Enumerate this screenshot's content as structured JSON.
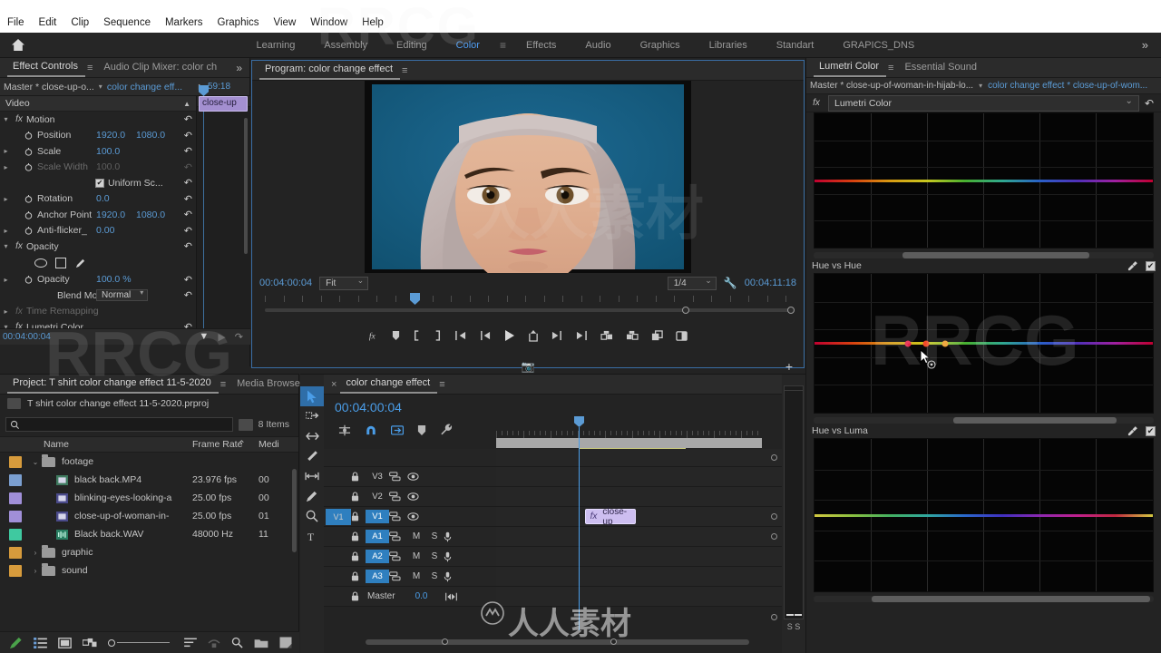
{
  "menu": {
    "items": [
      "File",
      "Edit",
      "Clip",
      "Sequence",
      "Markers",
      "Graphics",
      "View",
      "Window",
      "Help"
    ]
  },
  "workspace": {
    "home_icon": "home-icon",
    "tabs": [
      {
        "label": "Learning",
        "active": false
      },
      {
        "label": "Assembly",
        "active": false
      },
      {
        "label": "Editing",
        "active": false
      },
      {
        "label": "Color",
        "active": true
      },
      {
        "label": "Effects",
        "active": false
      },
      {
        "label": "Audio",
        "active": false
      },
      {
        "label": "Graphics",
        "active": false
      },
      {
        "label": "Libraries",
        "active": false
      },
      {
        "label": "Standart",
        "active": false
      },
      {
        "label": "GRAPICS_DNS",
        "active": false
      }
    ],
    "overflow": "»",
    "burger": "≡",
    "accent": "#4f9cf0"
  },
  "effect_controls": {
    "tabs": [
      {
        "label": "Effect Controls",
        "active": true
      },
      {
        "label": "Audio Clip Mixer: color ch",
        "active": false
      }
    ],
    "burger": "≡",
    "overflow": "»",
    "master_label": "Master * close-up-o...",
    "sequence_label": "color change eff...",
    "header_timecode": "59:18",
    "section_video": "Video",
    "clip_label": "close-up",
    "footer_timecode": "00:04:00:04",
    "groups": [
      {
        "name": "Motion",
        "fx": "fx",
        "expanded": true,
        "rows": [
          {
            "label": "Position",
            "stopwatch": true,
            "values": [
              "1920.0",
              "1080.0"
            ],
            "disabled": false,
            "twirl": false
          },
          {
            "label": "Scale",
            "stopwatch": true,
            "values": [
              "100.0"
            ],
            "disabled": false,
            "twirl": true
          },
          {
            "label": "Scale Width",
            "stopwatch": true,
            "values": [
              "100.0"
            ],
            "disabled": true,
            "twirl": true
          },
          {
            "label": "Uniform Sc...",
            "checkbox": true,
            "values": [],
            "disabled": false,
            "twirl": false
          },
          {
            "label": "Rotation",
            "stopwatch": true,
            "values": [
              "0.0"
            ],
            "disabled": false,
            "twirl": true
          },
          {
            "label": "Anchor Point",
            "stopwatch": true,
            "values": [
              "1920.0",
              "1080.0"
            ],
            "disabled": false,
            "twirl": false
          },
          {
            "label": "Anti-flicker_",
            "stopwatch": true,
            "values": [
              "0.00"
            ],
            "disabled": false,
            "twirl": true
          }
        ]
      },
      {
        "name": "Opacity",
        "fx": "fx",
        "expanded": true,
        "mask_tools": [
          "ellipse-mask",
          "rectangle-mask",
          "pen-mask"
        ],
        "rows": [
          {
            "label": "Opacity",
            "stopwatch": true,
            "values": [
              "100.0 %"
            ],
            "disabled": false,
            "twirl": true
          },
          {
            "label": "Blend Mode",
            "dropdown": "Normal",
            "values": [],
            "disabled": false,
            "twirl": false
          }
        ]
      },
      {
        "name": "Time Remapping",
        "fx": "fx",
        "expanded": false,
        "disabled": true,
        "rows": []
      },
      {
        "name": "Lumetri Color",
        "fx": "fx",
        "expanded": true,
        "mask_tools": [
          "ellipse-mask",
          "rectangle-mask",
          "pen-mask"
        ],
        "rows": []
      }
    ],
    "reset_icon": "reset-icon"
  },
  "program_monitor": {
    "tab_label": "Program: color change effect",
    "burger": "≡",
    "timecode_left": "00:04:00:04",
    "fit_value": "Fit",
    "resolution_value": "1/4",
    "wrench_icon": "settings-wrench-icon",
    "timecode_right": "00:04:11:18",
    "buttons": [
      {
        "icon": "fx-badge-icon",
        "name": "button-fx"
      },
      {
        "icon": "marker-icon",
        "name": "button-add-marker"
      },
      {
        "icon": "mark-in-icon",
        "name": "button-mark-in"
      },
      {
        "icon": "mark-out-icon",
        "name": "button-mark-out"
      },
      {
        "icon": "goto-in-icon",
        "name": "button-go-to-in"
      },
      {
        "icon": "step-back-icon",
        "name": "button-step-back"
      },
      {
        "icon": "play-icon",
        "name": "button-play-stop"
      },
      {
        "icon": "lift-icon",
        "name": "button-lift"
      },
      {
        "icon": "step-forward-icon",
        "name": "button-step-forward"
      },
      {
        "icon": "goto-out-icon",
        "name": "button-go-to-out"
      },
      {
        "icon": "insert-icon",
        "name": "button-insert"
      },
      {
        "icon": "overwrite-icon",
        "name": "button-overwrite"
      },
      {
        "icon": "export-frame-icon",
        "name": "button-export-frame"
      },
      {
        "icon": "comparison-view-icon",
        "name": "button-comparison-view"
      }
    ],
    "camera_button": "camera-icon",
    "plus_button": "+"
  },
  "lumetri": {
    "tabs": [
      {
        "label": "Lumetri Color",
        "active": true
      },
      {
        "label": "Essential Sound",
        "active": false
      }
    ],
    "burger": "≡",
    "master_label": "Master * close-up-of-woman-in-hijab-lo...",
    "sequence_label": "color change effect * close-up-of-wom...",
    "fx_label": "fx",
    "effect_name": "Lumetri Color",
    "reset_icon": "reset-icon",
    "curves": [
      {
        "title": "",
        "name": "hue-saturation-curve",
        "eyedropper": false,
        "checkbox": false,
        "points": [],
        "scroll_left_pct": 26,
        "scroll_width_pct": 55
      },
      {
        "title": "Hue vs Hue",
        "name": "hue-vs-hue-curve",
        "eyedropper": true,
        "checkbox": true,
        "points": [
          {
            "x_pct": 27.5,
            "color": "#e8254a"
          },
          {
            "x_pct": 33.0,
            "color": "#f04a28"
          },
          {
            "x_pct": 38.5,
            "color": "#f0a02a"
          }
        ],
        "scroll_left_pct": 41,
        "scroll_width_pct": 48
      },
      {
        "title": "Hue vs Luma",
        "name": "hue-vs-luma-curve",
        "eyedropper": true,
        "checkbox": true,
        "points": [],
        "scroll_left_pct": 17,
        "scroll_width_pct": 82
      }
    ],
    "eyedropper_icon": "eyedropper-icon",
    "checkbox_mark": "✔"
  },
  "project": {
    "tabs": [
      {
        "label": "Project: T shirt color change effect 11-5-2020",
        "active": true
      },
      {
        "label": "Media Browse",
        "active": false
      }
    ],
    "burger": "≡",
    "overflow": "»",
    "file_name": "T shirt color change effect 11-5-2020.prproj",
    "search_placeholder": "",
    "search_value": "",
    "item_count": "8 Items",
    "columns": [
      "Name",
      "Frame Rate",
      "Medi"
    ],
    "sort_arrow": "⌃",
    "rows": [
      {
        "name": "footage",
        "frame_rate": "",
        "media": "",
        "type": "bin",
        "chip": "#d79b3c",
        "indent": 0,
        "twirl": "⌄",
        "icon": "folder-icon"
      },
      {
        "name": "black back.MP4",
        "frame_rate": "23.976 fps",
        "media": "00",
        "type": "video",
        "chip": "#7b9fd0",
        "indent": 1,
        "twirl": "",
        "icon": "video-clip-icon"
      },
      {
        "name": "blinking-eyes-looking-a",
        "frame_rate": "25.00 fps",
        "media": "00",
        "type": "video",
        "chip": "#a08fd8",
        "indent": 1,
        "twirl": "",
        "icon": "video-clip-icon"
      },
      {
        "name": "close-up-of-woman-in-",
        "frame_rate": "25.00 fps",
        "media": "01",
        "type": "video",
        "chip": "#a08fd8",
        "indent": 1,
        "twirl": "",
        "icon": "video-clip-icon"
      },
      {
        "name": "Black back.WAV",
        "frame_rate": "48000 Hz",
        "media": "11",
        "type": "audio",
        "chip": "#3fc9a0",
        "indent": 1,
        "twirl": "",
        "icon": "audio-clip-icon"
      },
      {
        "name": "graphic",
        "frame_rate": "",
        "media": "",
        "type": "bin",
        "chip": "#d79b3c",
        "indent": 0,
        "twirl": "›",
        "icon": "folder-icon"
      },
      {
        "name": "sound",
        "frame_rate": "",
        "media": "",
        "type": "bin",
        "chip": "#d79b3c",
        "indent": 0,
        "twirl": "›",
        "icon": "folder-icon"
      }
    ],
    "footer_buttons": [
      {
        "icon": "pen-icon",
        "name": "project-pen-button"
      },
      {
        "icon": "list-view-icon",
        "name": "project-list-view-button"
      },
      {
        "icon": "icon-view-icon",
        "name": "project-icon-view-button"
      },
      {
        "icon": "freeform-view-icon",
        "name": "project-freeform-view-button"
      },
      {
        "icon": "zoom-slider",
        "name": "project-zoom-slider"
      },
      {
        "icon": "sort-icon",
        "name": "project-sort-button"
      },
      {
        "icon": "automate-icon",
        "name": "project-automate-button"
      },
      {
        "icon": "find-icon",
        "name": "project-find-button"
      },
      {
        "icon": "new-bin-icon",
        "name": "project-new-bin-button"
      },
      {
        "icon": "new-item-icon",
        "name": "project-new-item-button"
      }
    ]
  },
  "timeline": {
    "close_icon": "×",
    "sequence_name": "color change effect",
    "burger": "≡",
    "timecode": "00:04:00:04",
    "toolbar_icons": [
      {
        "icon": "nest-icon",
        "name": "insert-overwrite-toggle",
        "active": false
      },
      {
        "icon": "magnet-icon",
        "name": "snap-toggle",
        "active": true
      },
      {
        "icon": "linked-select-icon",
        "name": "linked-selection-toggle",
        "active": true
      },
      {
        "icon": "marker-icon",
        "name": "add-marker-button",
        "active": false
      },
      {
        "icon": "wrench-icon",
        "name": "timeline-settings-button",
        "active": false
      }
    ],
    "tracks": [
      {
        "name": "V3",
        "kind": "video",
        "targeted": false,
        "selected": false,
        "locked": false
      },
      {
        "name": "V2",
        "kind": "video",
        "targeted": false,
        "selected": false,
        "locked": false
      },
      {
        "name": "V1",
        "kind": "video",
        "targeted": true,
        "selected": true,
        "locked": false
      },
      {
        "name": "A1",
        "kind": "audio",
        "targeted": false,
        "selected": true,
        "locked": false,
        "mute": "M",
        "solo": "S"
      },
      {
        "name": "A2",
        "kind": "audio",
        "targeted": false,
        "selected": true,
        "locked": false,
        "mute": "M",
        "solo": "S"
      },
      {
        "name": "A3",
        "kind": "audio",
        "targeted": false,
        "selected": true,
        "locked": false,
        "mute": "M",
        "solo": "S"
      }
    ],
    "master_label": "Master",
    "master_value": "0.0",
    "clips": [
      {
        "label": "close-up",
        "fx": "fx",
        "track": "V1",
        "left_pct": 31,
        "width_pct": 18
      }
    ],
    "meters_label": "S S"
  },
  "colors": {
    "accent_blue": "#4a9de8",
    "panel_bg": "#232323",
    "tab_bg": "#2b2b2b",
    "clip_purple": "#cdbef0",
    "target_blue": "#2f7fbf"
  },
  "watermarks": {
    "rrcg": "RRCG",
    "chinese": "人人素材"
  }
}
